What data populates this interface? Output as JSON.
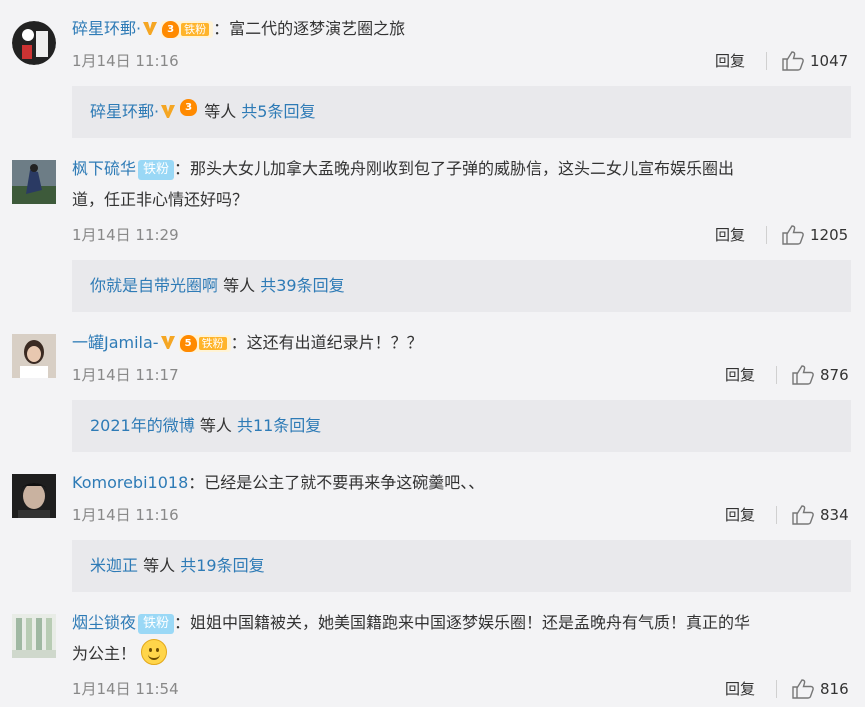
{
  "comments": [
    {
      "user": "碎星环郵·",
      "level": "3",
      "fan_label": "铁粉",
      "sep": "：",
      "text": "富二代的逐梦演艺圈之旅",
      "time": "1月14日 11:16",
      "reply_label": "回复",
      "likes": "1047",
      "sub_user": "碎星环郵·",
      "sub_etc": "等人",
      "sub_more": "共5条回复"
    },
    {
      "user": "枫下硫华",
      "fan_label": "铁粉",
      "sep": "：",
      "text": "那头大女儿加拿大孟晚舟刚收到包了子弹的威胁信，这头二女儿宣布娱乐圈出",
      "text2": "道，任正非心情还好吗？",
      "time": "1月14日 11:29",
      "reply_label": "回复",
      "likes": "1205",
      "sub_user": "你就是自带光圈啊",
      "sub_etc": "等人",
      "sub_more": "共39条回复"
    },
    {
      "user": "一罐Jamila-",
      "level": "5",
      "fan_label": "铁粉",
      "sep": "：",
      "text": "这还有出道纪录片！？？",
      "time": "1月14日 11:17",
      "reply_label": "回复",
      "likes": "876",
      "sub_user": "2021年的微博",
      "sub_etc": "等人",
      "sub_more": "共11条回复"
    },
    {
      "user": "Komorebi1018",
      "sep": "：",
      "text": "已经是公主了就不要再来争这碗羹吧、、",
      "time": "1月14日 11:16",
      "reply_label": "回复",
      "likes": "834",
      "sub_user": "米迦正",
      "sub_etc": "等人",
      "sub_more": "共19条回复"
    },
    {
      "user": "烟尘锁夜",
      "fan_label": "铁粉",
      "sep": "：",
      "text": "姐姐中国籍被关，她美国籍跑来中国逐梦娱乐圈！还是孟晚舟有气质！真正的华",
      "text2": "为公主！",
      "time": "1月14日 11:54",
      "reply_label": "回复",
      "likes": "816"
    }
  ],
  "colors": {
    "link": "#2e7bb6",
    "vip": "#f5a623",
    "fan": "#9ad8f6"
  }
}
